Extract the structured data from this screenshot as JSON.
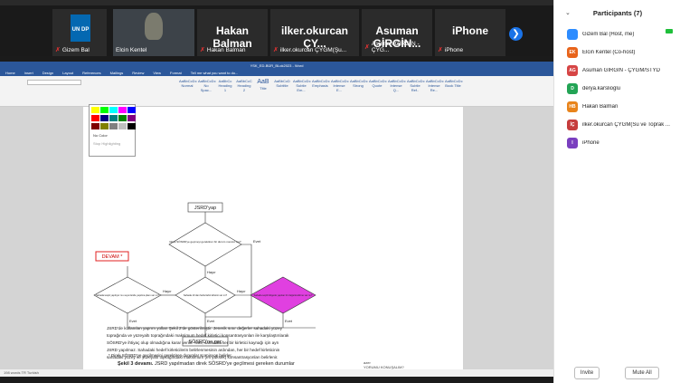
{
  "gallery": {
    "tiles": [
      {
        "name": "Gizem Bal"
      },
      {
        "name": "Elcin Kentel"
      },
      {
        "name": "Hakan Balman",
        "big": "Hakan Balman"
      },
      {
        "name": "ilker.okurcan ÇYGM(Şu...",
        "big": "ilker.okurcan ÇY..."
      },
      {
        "name": "Asuman GİRGİN - ÇYG...",
        "big": "Asuman GİRGİN..."
      },
      {
        "name": "iPhone",
        "big": "iPhone"
      }
    ],
    "un_logo": "UN DP"
  },
  "word": {
    "title": "YSK_ED-BÜR_BLok2023 - Word",
    "tabs": [
      "Home",
      "Insert",
      "Design",
      "Layout",
      "References",
      "Mailings",
      "Review",
      "View",
      "Format",
      "Tell me what you want to do..."
    ],
    "styles": [
      "Normal",
      "No Spac...",
      "Heading 1",
      "Heading 2",
      "Title",
      "Subtitle",
      "Subtle Em...",
      "Emphasis",
      "Intense E...",
      "Strong",
      "Quote",
      "Intense Q...",
      "Subtle Ref..",
      "Intense Re...",
      "Book Title"
    ],
    "palette_items": [
      "No Color",
      "Stop Highlighting"
    ],
    "flow": {
      "start": "JSRD'yap",
      "q1": "Direk SÖSRD'ye geçmeyi gerektiren bir durum mevcut mu?",
      "evet1": "Evet",
      "hayir1": "Hayır",
      "devam": "DEVAM *",
      "q2": "Sahada tespit yapılıyor mu veya ileride yapılma planı var mı?",
      "q3": "Sahada 10 dan fazla farklı kirletici var mı?",
      "q4": "Sahada seçili bölgede yapılan bir değerlendirme var mı?",
      "hayir": "Hayır",
      "evet": "Evet",
      "end": "SÖSRD'ne geç"
    },
    "footnote": "* Direk SÖSRD'ye geçilmesini gerektiren durumlar Komisyon belirler.",
    "caption_bold": "Şekil 3 devamı.",
    "caption": "JSRD yapılmadan direk SÖSRD'ye geçilmesi gereken durumlar",
    "para": [
      "JSRD'de kullanılan yaprım yolları Şekil 2'de gösterilmiştir. Jenerik sınır değerler sahadaki yüzey",
      "toprağında ve yüzeyaltı toprağındaki maksimum hedef kirletici konsantrasyonları ile karşılaştırılarak",
      "SÖSRD'ye ihtiyaç olup olmadığına karar verilir. Yani, sahadaki her bir kirletici kaynağı için ayrı",
      "JSRD yapılmaz. Sahadaki hedef kirleticilerin belirlenmesinin ardından, her bir hedef kirleticinin",
      "sahadaki yüzey ve yüzeyaltı toprağındaki maksimum (en yüksek) konsantrasyonları belirlenir."
    ],
    "comment_author": "azer",
    "comment_text": "YORUMU KONUŞALIM?",
    "status": "198 words   TR   Turkish"
  },
  "participants": {
    "title": "Participants (7)",
    "list": [
      {
        "initials": "",
        "name": "Gizem Bal (Host, me)",
        "color": "#2d8cff"
      },
      {
        "initials": "EK",
        "name": "Elcin Kentel (Co-host)",
        "color": "#e8641b"
      },
      {
        "initials": "AG",
        "name": "Asuman GİRGİN - ÇYGM/STYD",
        "color": "#d64545"
      },
      {
        "initials": "D",
        "name": "derya.karslioglu",
        "color": "#23a455"
      },
      {
        "initials": "HB",
        "name": "Hakan Balman",
        "color": "#e8841b"
      },
      {
        "initials": "İÇ",
        "name": "ilker.okurcan ÇYGM(Su ve Toprak ...",
        "color": "#c63c3c"
      },
      {
        "initials": "I",
        "name": "iPhone",
        "color": "#7a3fbf"
      }
    ],
    "invite": "Invite",
    "mute_all": "Mute All"
  }
}
